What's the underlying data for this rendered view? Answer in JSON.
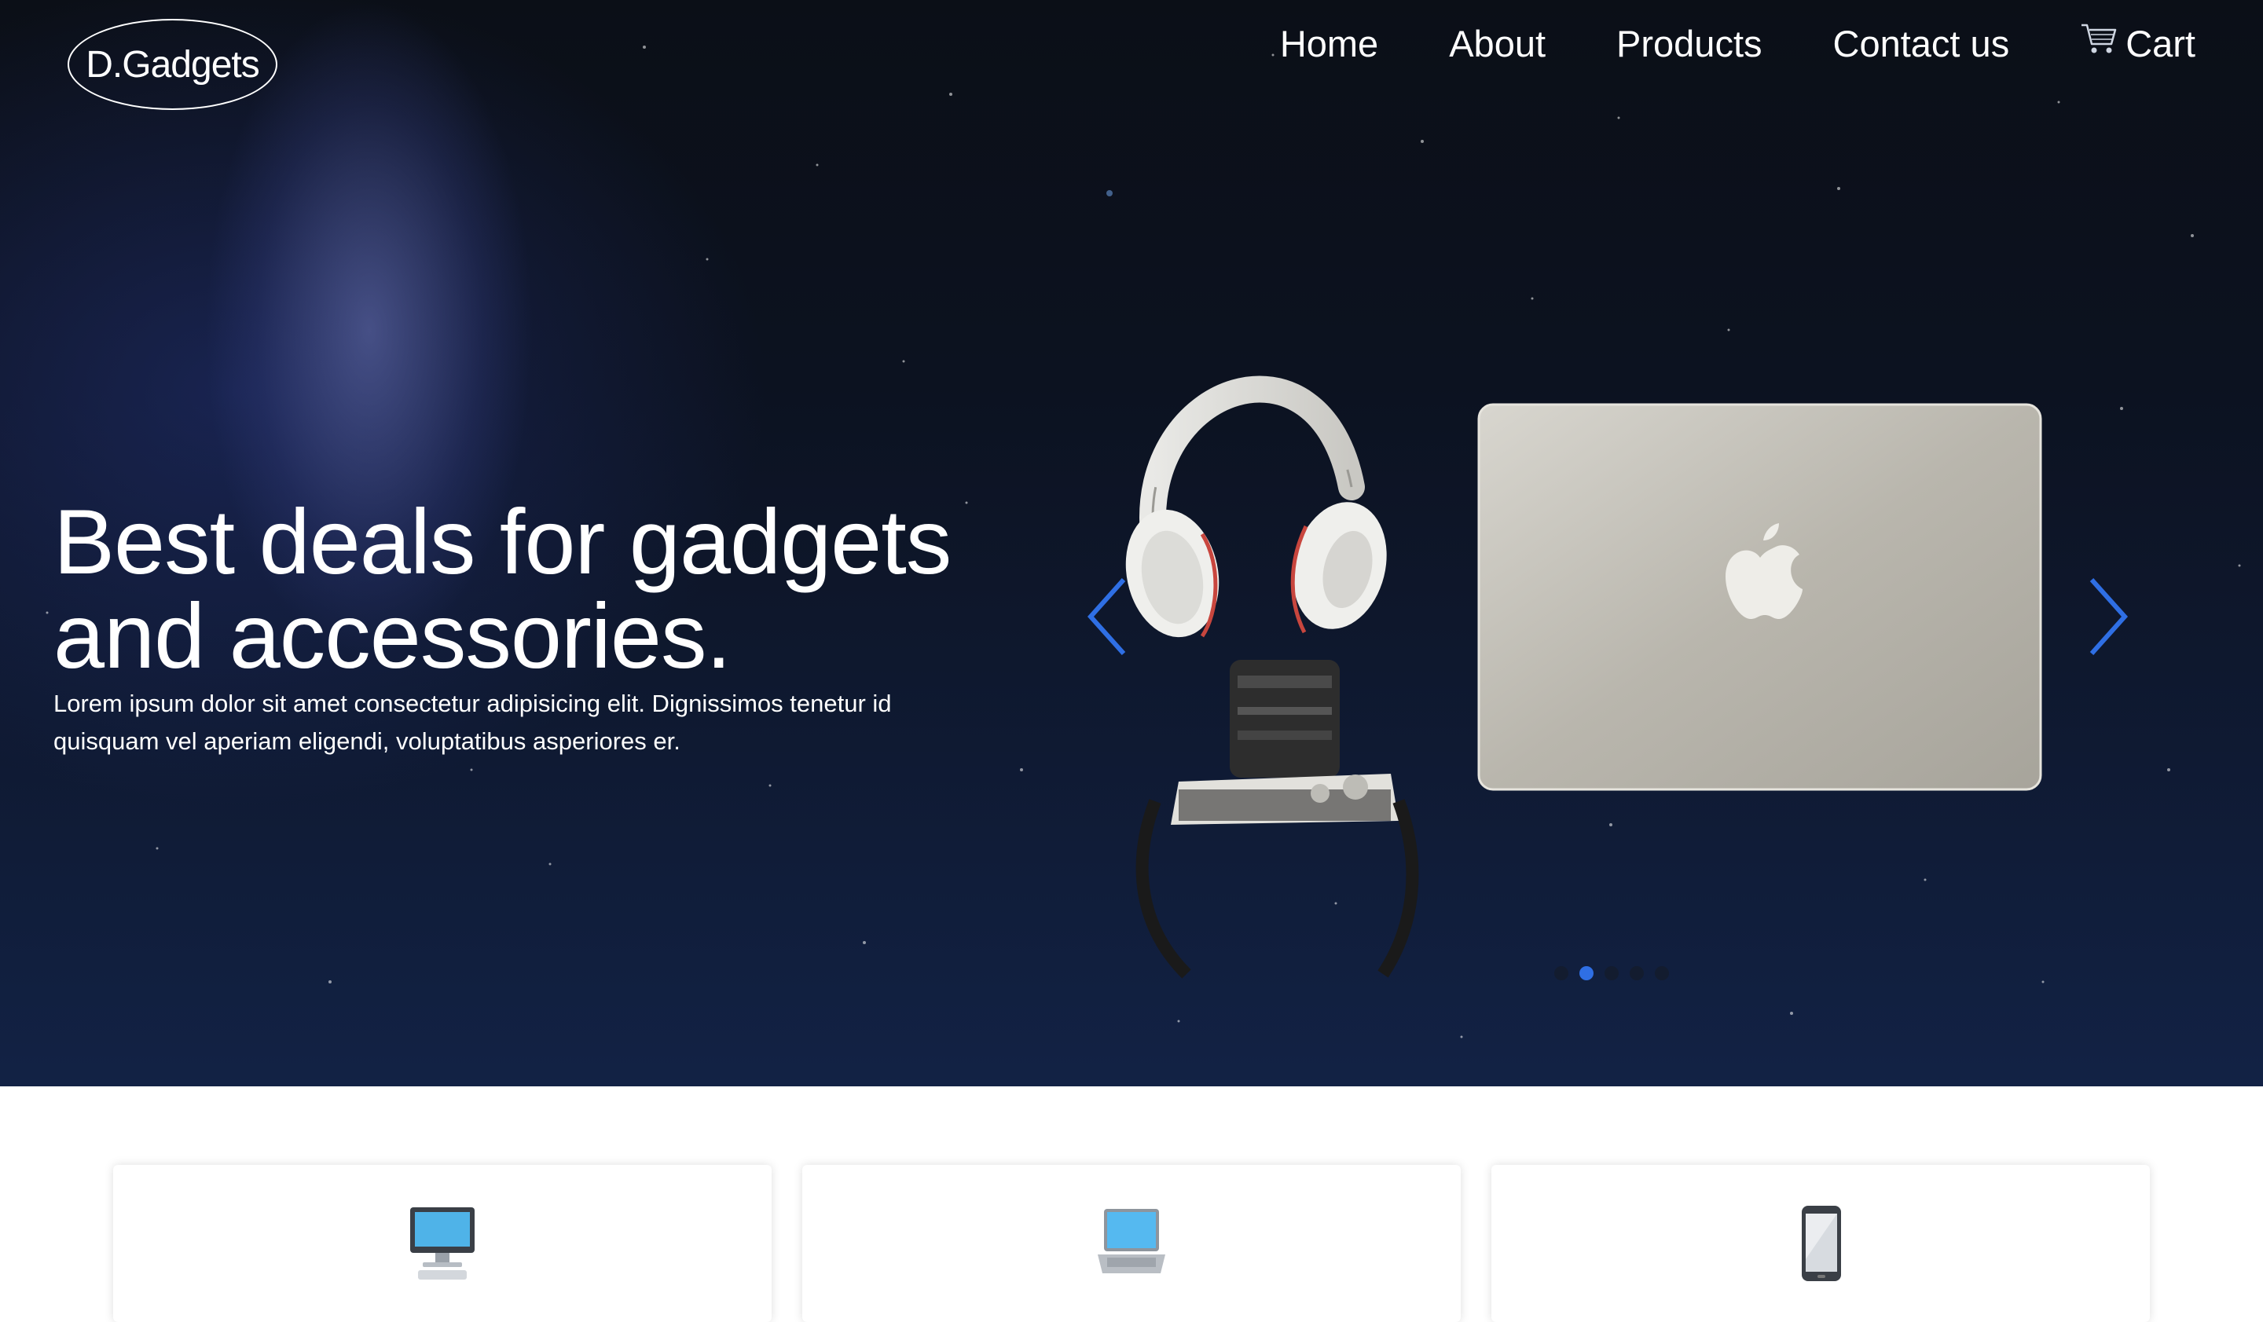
{
  "brand": {
    "name": "D.Gadgets"
  },
  "nav": {
    "items": [
      {
        "label": "Home"
      },
      {
        "label": "About"
      },
      {
        "label": "Products"
      },
      {
        "label": "Contact us"
      }
    ],
    "cart": {
      "label": "Cart",
      "icon": "shopping-cart-icon"
    }
  },
  "hero": {
    "headline": "Best deals for gadgets and accessories.",
    "subtext": "Lorem ipsum dolor sit amet consectetur adipisicing elit. Dignissimos tenetur id quisquam vel aperiam eligendi, voluptatibus asperiores er."
  },
  "carousel": {
    "slide_count": 5,
    "active_slide": 2,
    "prev_icon": "chevron-left-icon",
    "next_icon": "chevron-right-icon",
    "accent_color": "#2f6fe4"
  },
  "cards": [
    {
      "icon": "desktop-computer-icon"
    },
    {
      "icon": "laptop-icon"
    },
    {
      "icon": "mobile-phone-icon"
    }
  ]
}
